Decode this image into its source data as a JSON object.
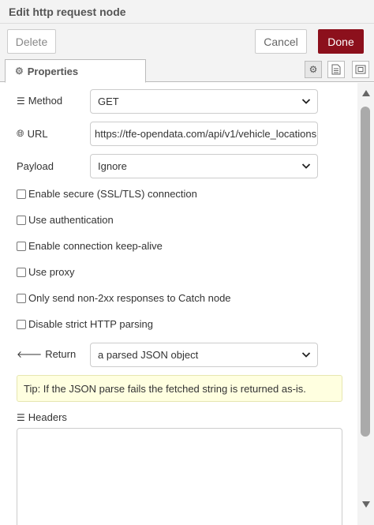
{
  "title": "Edit http request node",
  "toolbar": {
    "delete_label": "Delete",
    "cancel_label": "Cancel",
    "done_label": "Done"
  },
  "tabs": {
    "properties_label": "Properties"
  },
  "form": {
    "method": {
      "label": "Method",
      "value": "GET",
      "icon": "tasks-icon"
    },
    "url": {
      "label": "URL",
      "value": "https://tfe-opendata.com/api/v1/vehicle_locations",
      "icon": "globe-icon"
    },
    "payload": {
      "label": "Payload",
      "value": "Ignore"
    },
    "checkboxes": [
      {
        "label": "Enable secure (SSL/TLS) connection",
        "checked": false
      },
      {
        "label": "Use authentication",
        "checked": false
      },
      {
        "label": "Enable connection keep-alive",
        "checked": false
      },
      {
        "label": "Use proxy",
        "checked": false
      },
      {
        "label": "Only send non-2xx responses to Catch node",
        "checked": false
      },
      {
        "label": "Disable strict HTTP parsing",
        "checked": false
      }
    ],
    "return": {
      "label": "Return",
      "value": "a parsed JSON object",
      "icon": "arrow-left-icon"
    },
    "tip": "Tip: If the JSON parse fails the fetched string is returned as-is.",
    "headers": {
      "label": "Headers",
      "icon": "list-icon"
    }
  },
  "colors": {
    "done_button": "#8c101c",
    "tip_background": "#ffffe0"
  }
}
